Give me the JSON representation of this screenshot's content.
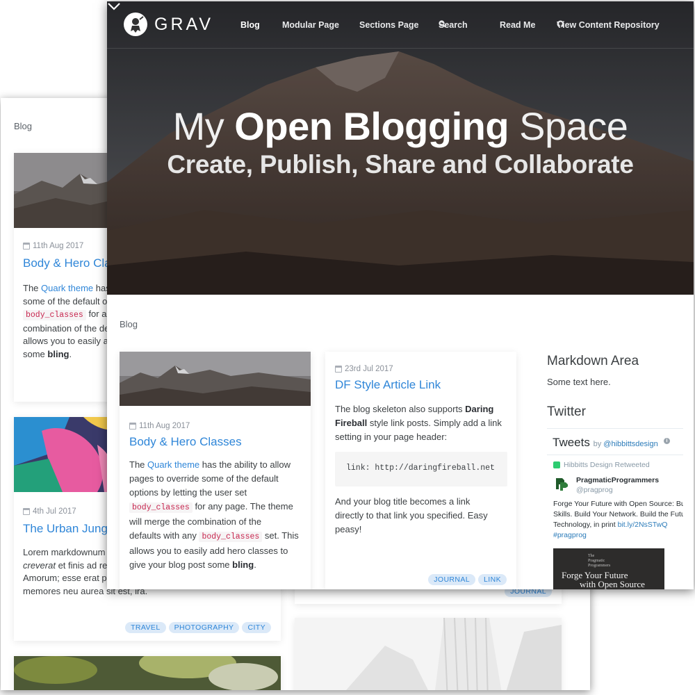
{
  "back": {
    "breadcrumb": "Blog",
    "post1": {
      "date": "11th Aug 2017",
      "title": "Body & Hero Clas",
      "line1_pre": "The ",
      "line1_link": "Quark theme",
      "line1_post": " has",
      "line2": "some of the default o",
      "line3_code": "body_classes",
      "line3_post": " for an",
      "line4": "combination of the de",
      "line5": "allows you to easily a",
      "line6_pre": "some ",
      "line6_bold": "bling",
      "line6_post": "."
    },
    "post2": {
      "date": "4th Jul 2017",
      "title": "The Urban Jungl",
      "line1": "Lorem markdownum",
      "line2_italic": "creverat",
      "line2_post": " et finis ad re",
      "line3": "Amorum; esse erat pa",
      "line4": "memores neu aurea sit est, ira.",
      "tags": [
        "TRAVEL",
        "PHOTOGRAPHY",
        "CITY"
      ]
    },
    "post3": {
      "tags": [
        "JOURNAL"
      ]
    }
  },
  "front": {
    "logo_text": "GRAV",
    "nav": {
      "blog": "Blog",
      "modular": "Modular Page",
      "sections": "Sections Page",
      "search": "Search",
      "readme": "Read Me",
      "repo": "View Content Repository"
    },
    "hero": {
      "title_pre": "My ",
      "title_bold": "Open Blogging",
      "title_post": " Space",
      "subtitle": "Create, Publish, Share and Collaborate"
    },
    "breadcrumb": "Blog",
    "post1": {
      "date": "11th Aug 2017",
      "title": "Body & Hero Classes",
      "l1_pre": "The ",
      "l1_link": "Quark theme",
      "l1_post": " has the ability to allow",
      "l2": "pages to override some of the default",
      "l3": "options by letting the user set",
      "l4_code": "body_classes",
      "l4_post": " for any page. The theme",
      "l5": "will merge the combination of the",
      "l6_pre": "defaults with any ",
      "l6_code": "body_classes",
      "l6_post": " set. This",
      "l7": "allows you to easily add hero classes to",
      "l8_pre": "give your blog post some ",
      "l8_bold": "bling",
      "l8_post": "."
    },
    "post2": {
      "date": "23rd Jul 2017",
      "title": "DF Style Article Link",
      "l1_pre": "The blog skeleton also supports ",
      "l1_bold": "Daring",
      "l2_bold": "Fireball",
      "l2_post": " style link posts. Simply add a link",
      "l3": "setting in your page header:",
      "code": "link: http://daringfireball.net",
      "l4": "And your blog title becomes a link",
      "l5": "directly to that link you specified. Easy",
      "l6": "peasy!",
      "tags": [
        "JOURNAL",
        "LINK"
      ]
    },
    "sidebar": {
      "markdown_title": "Markdown Area",
      "markdown_text": "Some text here.",
      "twitter_title": "Twitter"
    },
    "twitter": {
      "header": "Tweets",
      "by": "by ",
      "by_handle": "@hibbittsdesign",
      "info": "i",
      "retweet": "Hibbitts Design Retweeted",
      "name": "PragmaticProgrammers",
      "handle": "@pragprog",
      "t1": "Forge Your Future with Open Source: Bui",
      "t2": "Skills. Build Your Network. Build the Futu",
      "t3_pre": "Technology, in print ",
      "t3_link": "bit.ly/2NsSTwQ",
      "t4": "#pragprog",
      "img_small_1": "The",
      "img_small_2": "Pragmatic",
      "img_small_3": "Programmers",
      "img_title_1": "Forge Your Future",
      "img_title_2": "with Open Source"
    }
  },
  "colors": {
    "link": "#2f86d8",
    "tag_bg": "#dbe9f8",
    "code": "#c7254e"
  }
}
